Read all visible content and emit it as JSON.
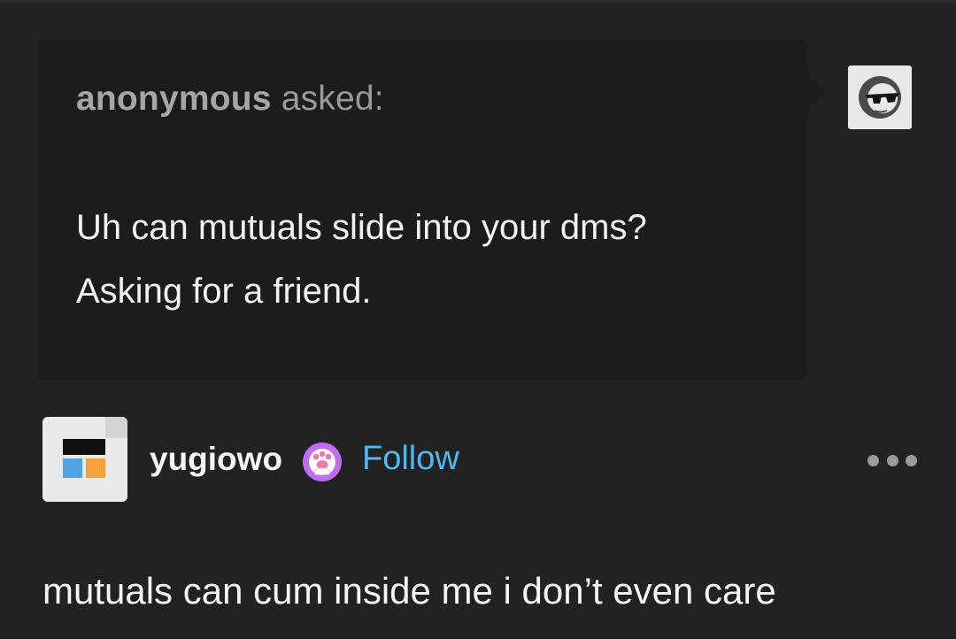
{
  "ask": {
    "asker_name": "anonymous",
    "asked_label": "asked:",
    "question_lines": [
      "Uh can mutuals slide into your dms?",
      "Asking for a friend."
    ],
    "avatar_icon": "sunglasses-face-icon"
  },
  "reply": {
    "username": "yugiowo",
    "badge_icon": "paw-badge-icon",
    "follow_label": "Follow",
    "more_icon": "more-options-icon",
    "body": "mutuals can cum inside me i don’t even care"
  },
  "colors": {
    "background": "#222222",
    "bubble": "#1c1c1c",
    "follow": "#4fb8ee",
    "badge": "#c26cf0"
  }
}
